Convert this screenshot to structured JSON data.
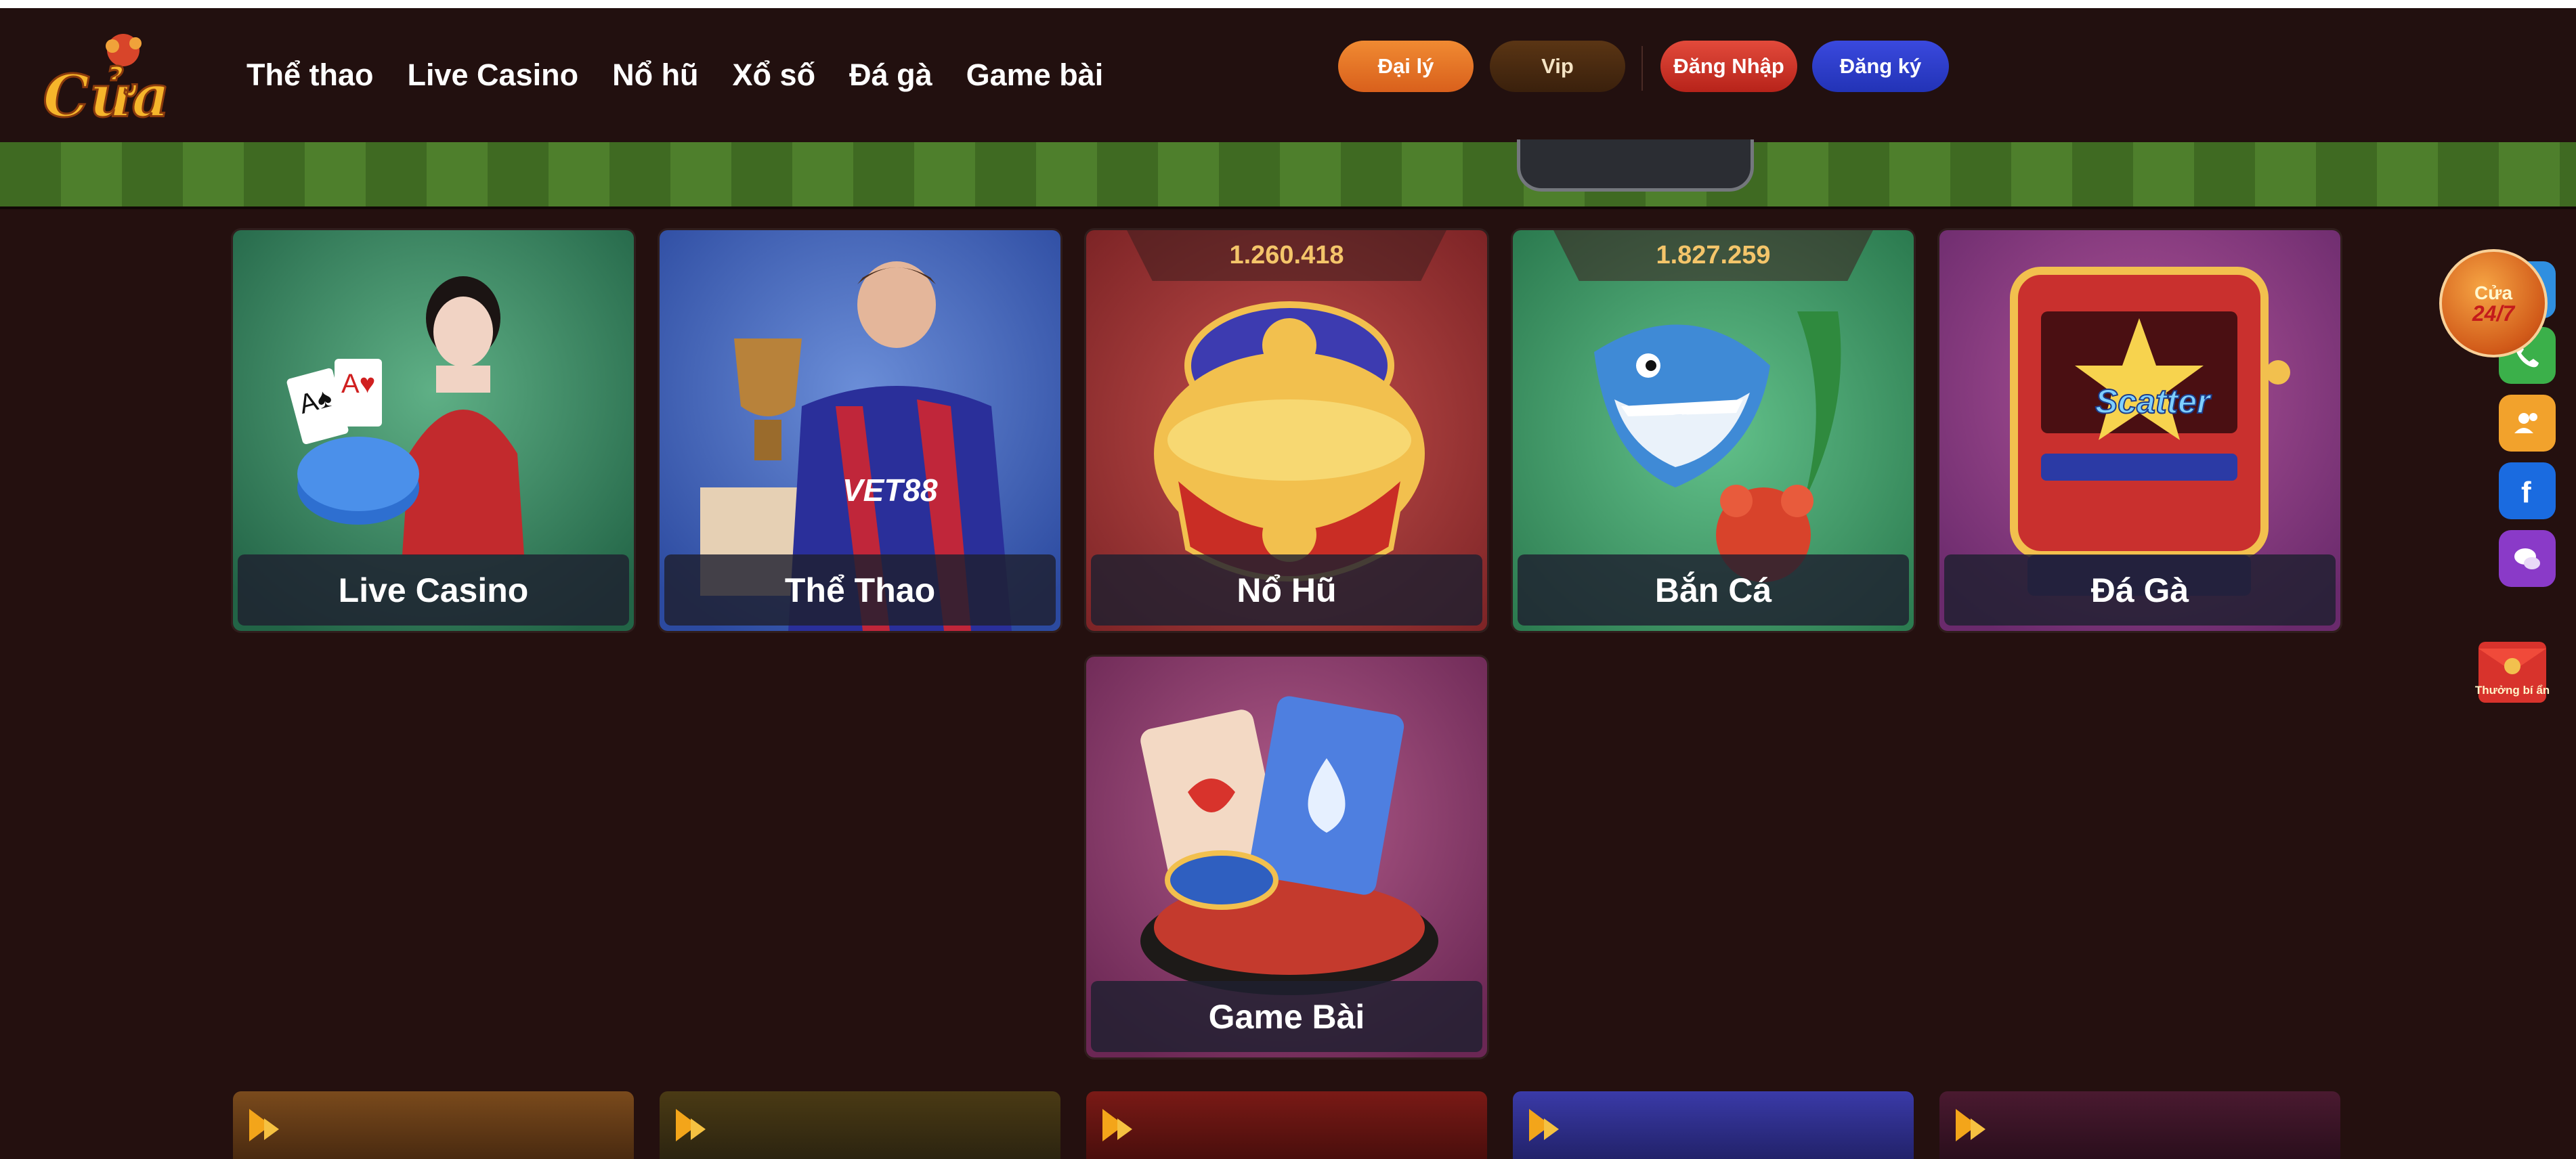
{
  "header": {
    "logo_text": "Cửa",
    "nav": [
      "Thể thao",
      "Live Casino",
      "Nổ hũ",
      "Xổ số",
      "Đá gà",
      "Game bài"
    ],
    "buttons": {
      "agent": "Đại lý",
      "vip": "Vip",
      "login": "Đăng Nhập",
      "register": "Đăng ký"
    }
  },
  "cards": [
    {
      "label": "Live Casino",
      "jackpot": null
    },
    {
      "label": "Thể Thao",
      "jackpot": null
    },
    {
      "label": "Nổ Hũ",
      "jackpot": "1.260.418"
    },
    {
      "label": "Bắn Cá",
      "jackpot": "1.827.259"
    },
    {
      "label": "Đá Gà",
      "jackpot": null
    },
    {
      "label": "Game Bài",
      "jackpot": null
    }
  ],
  "jersey_text": "VET88",
  "side": {
    "support_line1": "Cửa",
    "support_line2": "24/7",
    "reward_label": "Thưởng bí ẩn",
    "icons": [
      "telegram-icon",
      "phone-icon",
      "users-icon",
      "facebook-icon",
      "chat-icon"
    ]
  }
}
